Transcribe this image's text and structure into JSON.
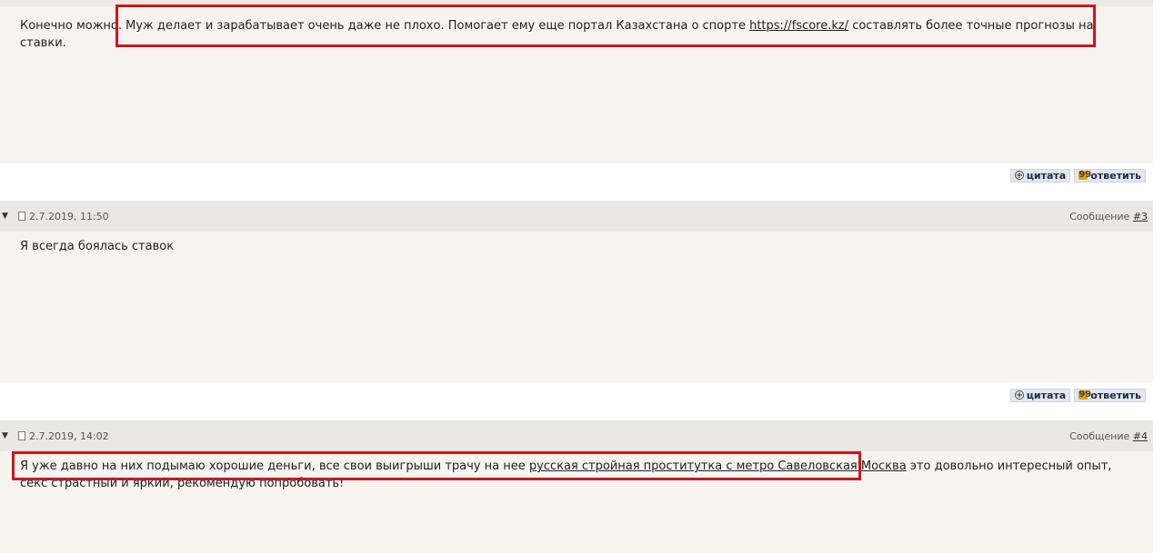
{
  "posts": [
    {
      "text_before": "Конечно можно. Муж делает и зарабатывает очень даже не плохо. Помогает ему еще портал Казахстана о спорте ",
      "link": "https://fscore.kz/",
      "text_after": " составлять более точные прогнозы на ставки."
    },
    {
      "date": "2.7.2019, 11:50",
      "message_label": "Сообщение",
      "message_num": "#3",
      "text": "Я всегда боялась ставок"
    },
    {
      "date": "2.7.2019, 14:02",
      "message_label": "Сообщение",
      "message_num": "#4",
      "text_before": "Я уже давно на них подымаю хорошие деньги, все свои выигрыши трачу на нее ",
      "link": "русская стройная проститутка с метро Савеловская Москва",
      "text_after": " это довольно интересный опыт, секс страстный и яркий, рекомендую попробовать!"
    }
  ],
  "actions": {
    "quote_label": "цитата",
    "reply_label": "ответить",
    "quote_icon": "plus-circle-icon",
    "reply_icon": "reply-icon"
  },
  "colors": {
    "panel_bg": "#f7f4ef",
    "header_bg": "#ebe8e3",
    "highlight": "#d0141c"
  }
}
